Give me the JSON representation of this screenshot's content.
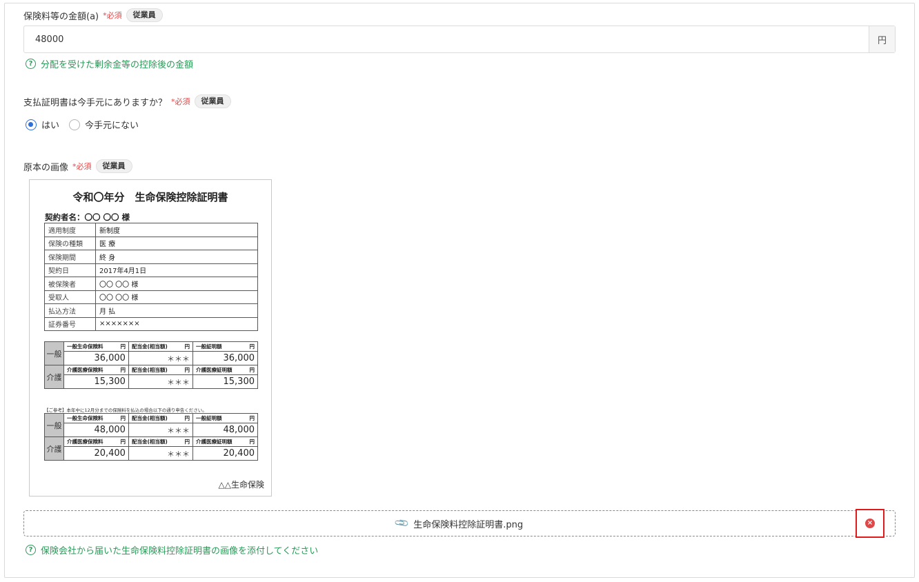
{
  "common": {
    "required": "*必須",
    "role_badge": "従業員",
    "hint_icon": "?"
  },
  "premium": {
    "label": "保険料等の金額(a)",
    "value": "48000",
    "unit": "円",
    "hint": "分配を受けた剰余金等の控除後の金額"
  },
  "certificate_question": {
    "label": "支払証明書は今手元にありますか？",
    "options": [
      {
        "label": "はい",
        "checked": true
      },
      {
        "label": "今手元にない",
        "checked": false
      }
    ]
  },
  "original_image": {
    "label": "原本の画像",
    "certificate": {
      "title": "令和〇年分　生命保険控除証明書",
      "contractor": "契約者名：〇〇 〇〇 様",
      "rows": [
        {
          "key": "適用制度",
          "value": "新制度"
        },
        {
          "key": "保険の種類",
          "value": "医 療"
        },
        {
          "key": "保険期間",
          "value": "終 身"
        },
        {
          "key": "契約日",
          "value": "2017年4月1日"
        },
        {
          "key": "被保険者",
          "value": "〇〇 〇〇 様"
        },
        {
          "key": "受取人",
          "value": "〇〇 〇〇 様"
        },
        {
          "key": "払込方法",
          "value": "月 払"
        },
        {
          "key": "証券番号",
          "value": "×××××××"
        }
      ],
      "yen": "円",
      "section1": {
        "general": {
          "side": "一般",
          "headers": [
            "一般生命保険料",
            "配当金(相当額)",
            "一般証明額"
          ],
          "values": [
            "36,000",
            "＊＊＊",
            "36,000"
          ]
        },
        "care": {
          "side": "介護",
          "headers": [
            "介護医療保険料",
            "配当金(相当額)",
            "介護医療証明額"
          ],
          "values": [
            "15,300",
            "＊＊＊",
            "15,300"
          ]
        }
      },
      "note": "【ご参考】本年中に12月分までの保険料を払込の場合以下の通り申告ください。",
      "section2": {
        "general": {
          "side": "一般",
          "headers": [
            "一般生命保険料",
            "配当金(相当額)",
            "一般証明額"
          ],
          "values": [
            "48,000",
            "＊＊＊",
            "48,000"
          ]
        },
        "care": {
          "side": "介護",
          "headers": [
            "介護医療保険料",
            "配当金(相当額)",
            "介護医療証明額"
          ],
          "values": [
            "20,400",
            "＊＊＊",
            "20,400"
          ]
        }
      },
      "issuer": "△△生命保険"
    },
    "file_name": "生命保険料控除証明書.png",
    "clip_icon": "paperclip-icon",
    "remove_icon": "close-circle-icon",
    "remove_symbol": "×",
    "hint": "保険会社から届いた生命保険料控除証明書の画像を添付してください"
  },
  "colors": {
    "hint": "#2a9a58",
    "required": "#e04848",
    "radio": "#2f6fd8",
    "highlight": "#e01a1a"
  }
}
